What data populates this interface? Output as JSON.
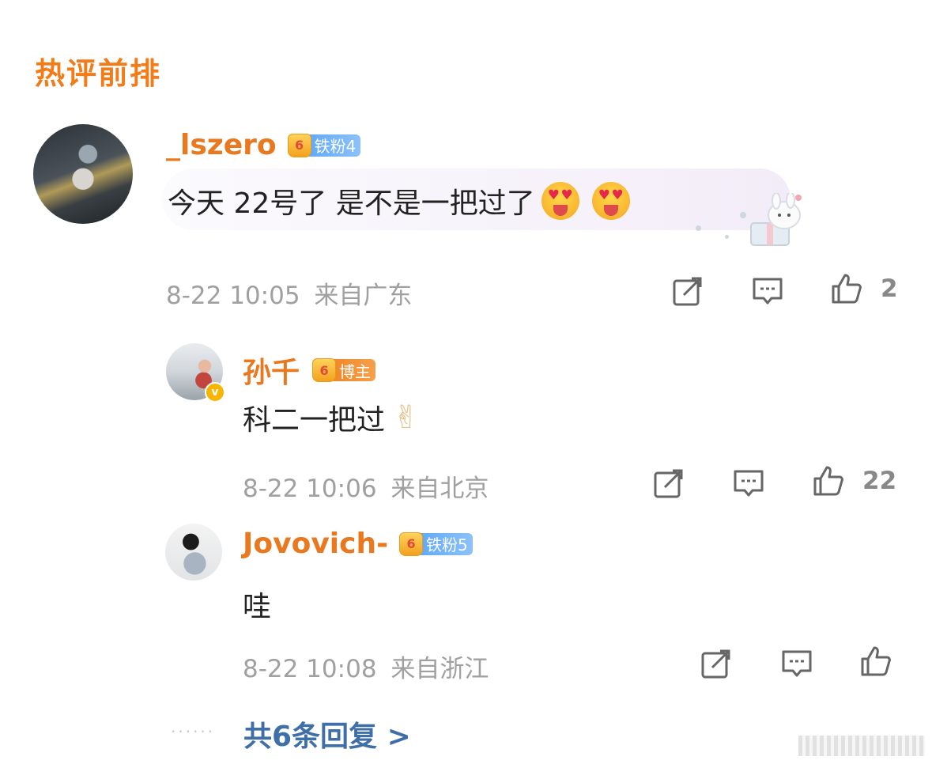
{
  "section_title": "热评前排",
  "comments": [
    {
      "username": "_lszero",
      "badge_level": "6",
      "badge_label": "铁粉4",
      "text": "今天 22号了 是不是一把过了",
      "time": "8-22 10:05",
      "location": "来自广东",
      "like_count": "2"
    },
    {
      "username": "孙千",
      "badge_level": "6",
      "badge_label": "博主",
      "verified_mark": "v",
      "text": "科二一把过",
      "time": "8-22 10:06",
      "location": "来自北京",
      "like_count": "22"
    },
    {
      "username": "Jovovich-",
      "badge_level": "6",
      "badge_label": "铁粉5",
      "text": "哇",
      "time": "8-22 10:08",
      "location": "来自浙江",
      "like_count": ""
    }
  ],
  "more": {
    "dots": "······",
    "label": "共6条回复 >"
  },
  "colors": {
    "username": "#e9781f",
    "title": "#f27c1a",
    "link": "#3f6fa8",
    "badge_blue": "#6aaef8",
    "badge_orange": "#f08726"
  },
  "icons": [
    "repost-icon",
    "comment-icon",
    "like-icon",
    "heart-eyes-emoji",
    "victory-hand-emoji",
    "crown-badge-icon",
    "verified-icon"
  ]
}
